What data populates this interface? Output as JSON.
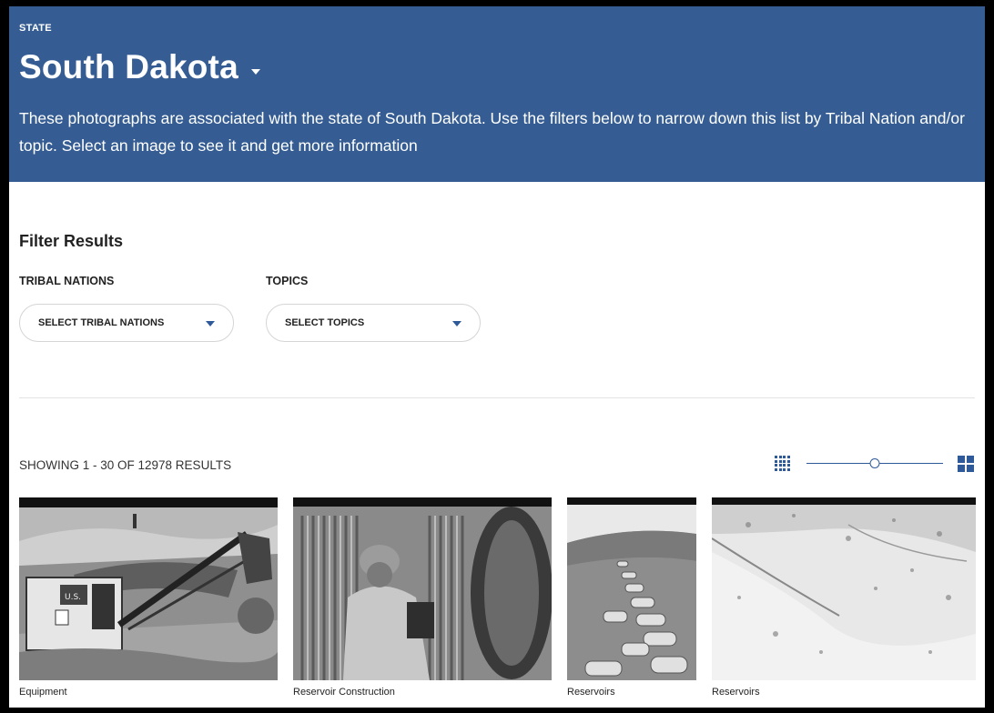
{
  "hero": {
    "eyebrow": "STATE",
    "title": "South Dakota",
    "description": "These photographs are associated with the state of South Dakota. Use the filters below to narrow down this list by Tribal Nation and/or topic. Select an image to see it and get more information"
  },
  "filters": {
    "heading": "Filter Results",
    "tribal": {
      "label": "TRIBAL NATIONS",
      "value": "SELECT TRIBAL NATIONS"
    },
    "topics": {
      "label": "TOPICS",
      "value": "SELECT TOPICS"
    }
  },
  "results": {
    "summary": "SHOWING 1 - 30 OF 12978 RESULTS",
    "zoom_level_fraction": 0.5
  },
  "photos": [
    {
      "caption": "Equipment",
      "scene": "steam-shovel-excavation"
    },
    {
      "caption": "Reservoir Construction",
      "scene": "worker-corrugated-pipe"
    },
    {
      "caption": "Reservoirs",
      "scene": "culvert-pipes-field"
    },
    {
      "caption": "Reservoirs",
      "scene": "reservoir-slope"
    }
  ],
  "colors": {
    "hero_background": "#355d93",
    "accent": "#2f5a9a"
  },
  "icons": [
    "chevron-down-icon",
    "grid-small-icon",
    "grid-large-icon"
  ]
}
